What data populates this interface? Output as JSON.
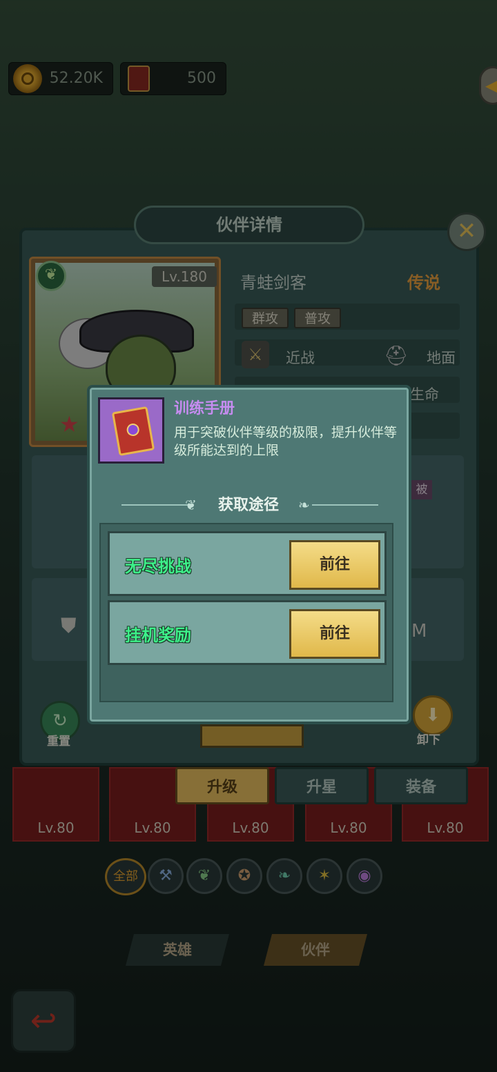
{
  "resources": {
    "gold": "52.20K",
    "books": "500"
  },
  "panel": {
    "title": "伙伴详情",
    "level": "Lv.180",
    "name": "青蛙剑客",
    "rarity": "传说",
    "tags": [
      "群攻",
      "普攻"
    ],
    "attack_type": "近战",
    "terrain": "地面",
    "partial_stat": "生命",
    "partial_badge": "被",
    "partial_value": "M",
    "reset_label": "重置",
    "unequip_label": "卸下"
  },
  "tabs": {
    "upgrade": "升级",
    "star": "升星",
    "equip": "装备"
  },
  "hero_levels": [
    "Lv.80",
    "Lv.80",
    "Lv.80",
    "Lv.80",
    "Lv.80"
  ],
  "filters": {
    "all": "全部"
  },
  "nav": {
    "heroes": "英雄",
    "partners": "伙伴"
  },
  "popup": {
    "item_name": "训练手册",
    "item_desc": "用于突破伙伴等级的极限，提升伙伴等级所能达到的上限",
    "source_title": "获取途径",
    "sources": [
      {
        "name": "无尽挑战",
        "button": "前往"
      },
      {
        "name": "挂机奖励",
        "button": "前往"
      }
    ]
  },
  "colors": {
    "rarity": "#e8a040",
    "item_name": "#c68cf0",
    "source_name": "#3ef08a",
    "go_button": "#e0b84a"
  }
}
